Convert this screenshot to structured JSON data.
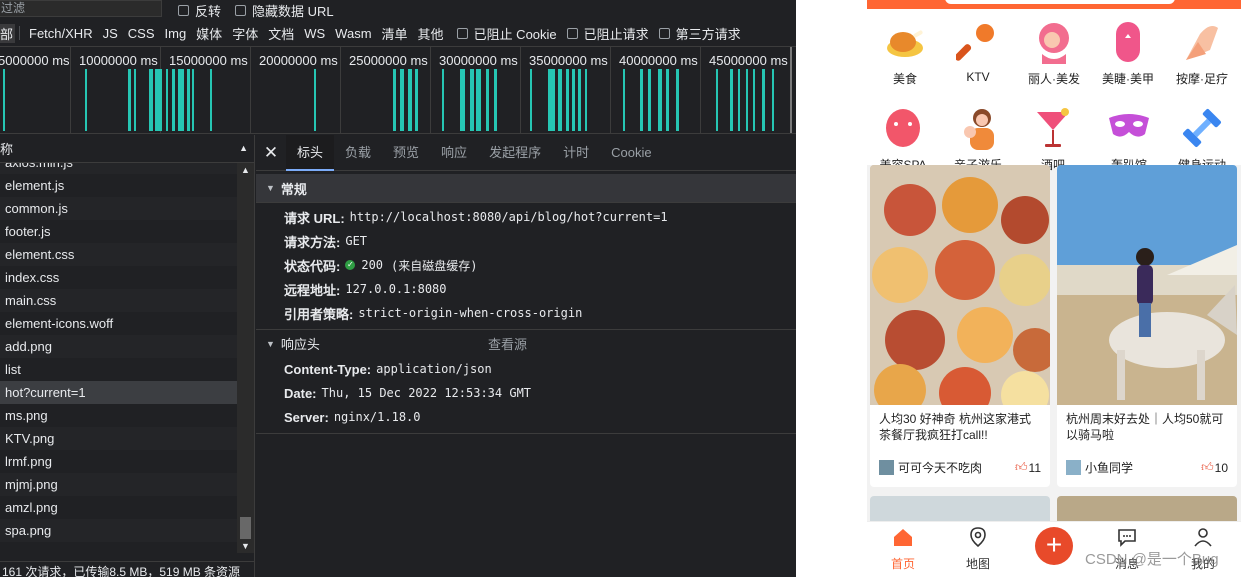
{
  "devtools": {
    "filter": {
      "placeholder": "过滤"
    },
    "checkboxes": [
      {
        "label": "反转"
      },
      {
        "label": "隐藏数据 URL"
      }
    ],
    "type_filters": [
      "部",
      "Fetch/XHR",
      "JS",
      "CSS",
      "Img",
      "媒体",
      "字体",
      "文档",
      "WS",
      "Wasm",
      "清单",
      "其他"
    ],
    "blocked": [
      {
        "label": "已阻止 Cookie"
      },
      {
        "label": "已阻止请求"
      },
      {
        "label": "第三方请求"
      }
    ],
    "timeline_labels": [
      "5000000 ms",
      "10000000 ms",
      "15000000 ms",
      "20000000 ms",
      "25000000 ms",
      "30000000 ms",
      "35000000 ms",
      "40000000 ms",
      "45000000 ms"
    ],
    "list_header": "称",
    "requests": [
      "axios.min.js",
      "element.js",
      "common.js",
      "footer.js",
      "element.css",
      "index.css",
      "main.css",
      "element-icons.woff",
      "add.png",
      "list",
      "hot?current=1",
      "ms.png",
      "KTV.png",
      "lrmf.png",
      "mjmj.png",
      "amzl.png",
      "spa.png"
    ],
    "selected_request": "hot?current=1",
    "status_line": "161 次请求，已传输8.5 MB，519 MB 条资源",
    "detail_tabs": [
      "标头",
      "负载",
      "预览",
      "响应",
      "发起程序",
      "计时",
      "Cookie"
    ],
    "active_tab": "标头",
    "general": {
      "title": "常规",
      "request_url_key": "请求 URL:",
      "request_url": "http://localhost:8080/api/blog/hot?current=1",
      "method_key": "请求方法:",
      "method": "GET",
      "status_key": "状态代码:",
      "status": "200",
      "status_note": "(来自磁盘缓存)",
      "remote_key": "远程地址:",
      "remote": "127.0.0.1:8080",
      "referrer_key": "引用者策略:",
      "referrer": "strict-origin-when-cross-origin"
    },
    "response_headers": {
      "title": "响应头",
      "view_source": "查看源",
      "items": [
        {
          "k": "Content-Type:",
          "v": "application/json"
        },
        {
          "k": "Date:",
          "v": "Thu, 15 Dec 2022 12:53:34 GMT"
        },
        {
          "k": "Server:",
          "v": "nginx/1.18.0"
        }
      ]
    }
  },
  "app": {
    "categories": [
      {
        "label": "美食",
        "icon": "roast-chicken-icon",
        "color": "#f59b2b"
      },
      {
        "label": "KTV",
        "icon": "microphone-icon",
        "color": "#f07a2a"
      },
      {
        "label": "丽人·美发",
        "icon": "hair-salon-icon",
        "color": "#f26d8f"
      },
      {
        "label": "美睫·美甲",
        "icon": "nail-icon",
        "color": "#f0568a"
      },
      {
        "label": "按摩·足疗",
        "icon": "massage-hand-icon",
        "color": "#f4a07a"
      },
      {
        "label": "美容SPA",
        "icon": "face-mask-icon",
        "color": "#f2566a"
      },
      {
        "label": "亲子游乐",
        "icon": "parent-child-icon",
        "color": "#f08a3a"
      },
      {
        "label": "酒吧",
        "icon": "cocktail-icon",
        "color": "#ef4f7a"
      },
      {
        "label": "轰趴馆",
        "icon": "party-mask-icon",
        "color": "#c54fd8"
      },
      {
        "label": "健身运动",
        "icon": "dumbbell-icon",
        "color": "#3a86f0"
      }
    ],
    "cards": [
      {
        "title": "人均30 好神奇 杭州这家港式茶餐厅我疯狂打call!!",
        "author": "可可今天不吃肉",
        "likes": "11"
      },
      {
        "title": "杭州周末好去处｜人均50就可以骑马啦",
        "author": "小鱼同学",
        "likes": "10"
      }
    ],
    "tabs": [
      {
        "label": "首页",
        "icon": "home-icon"
      },
      {
        "label": "地图",
        "icon": "map-pin-icon"
      },
      {
        "label": "消息",
        "icon": "message-icon"
      },
      {
        "label": "我的",
        "icon": "user-icon"
      }
    ],
    "watermark": "CSDN @是一个Bug",
    "accent": "#ff6633"
  }
}
